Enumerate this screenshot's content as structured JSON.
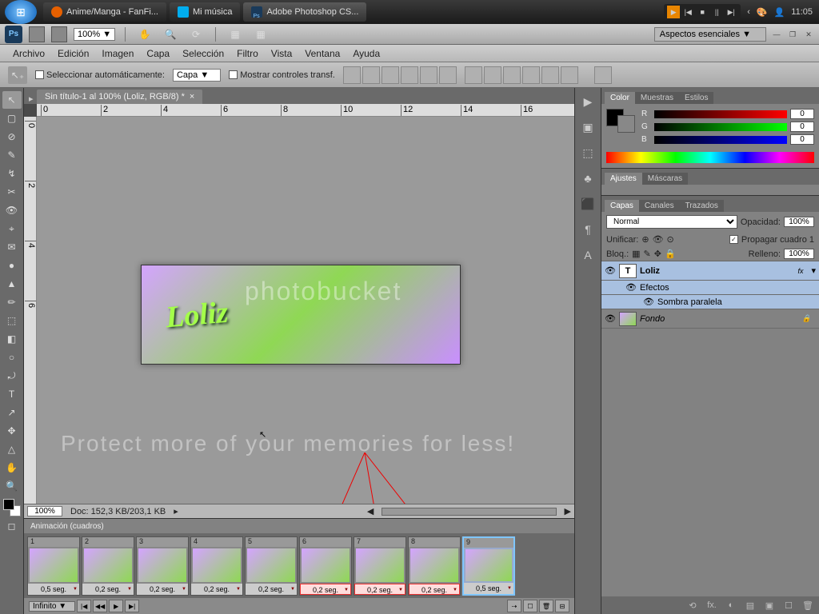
{
  "taskbar": {
    "items": [
      {
        "icon": "ff",
        "label": "Anime/Manga - FanFi..."
      },
      {
        "icon": "wmp",
        "label": "Mi música"
      },
      {
        "icon": "ps",
        "label": "Adobe Photoshop CS...",
        "active": true
      }
    ],
    "clock": "11:05",
    "media": {
      "play": "▶",
      "prev": "|◀",
      "stop": "■",
      "pause": "||",
      "next": "▶|"
    }
  },
  "top": {
    "zoom": "100% ▼",
    "icons": {
      "hand": "✋",
      "zoom": "🔍",
      "rotate": "⟳",
      "arrange1": "▦",
      "arrange2": "▦",
      "screen": "▢"
    },
    "workspace": "Aspectos esenciales  ▼"
  },
  "menu": [
    "Archivo",
    "Edición",
    "Imagen",
    "Capa",
    "Selección",
    "Filtro",
    "Vista",
    "Ventana",
    "Ayuda"
  ],
  "options": {
    "auto_select": "Seleccionar automáticamente:",
    "layer_select": "Capa        ▼",
    "show_transform": "Mostrar controles transf."
  },
  "document": {
    "tab": "Sin título-1 al 100% (Loliz, RGB/8) *",
    "ruler_h": [
      0,
      2,
      4,
      6,
      8,
      10,
      12,
      14,
      16
    ],
    "ruler_v": [
      0,
      2,
      4,
      6
    ],
    "art_text": "Loliz",
    "zoom": "100%",
    "docsize": "Doc: 152,3 KB/203,1 KB"
  },
  "watermark": {
    "wm1": "photobucket",
    "wm2": "Protect more of  your memories for less!"
  },
  "animation": {
    "title": "Animación (cuadros)",
    "frames": [
      {
        "n": 1,
        "d": "0,5 seg.",
        "hl": false,
        "sel": false
      },
      {
        "n": 2,
        "d": "0,2 seg.",
        "hl": false,
        "sel": false
      },
      {
        "n": 3,
        "d": "0,2 seg.",
        "hl": false,
        "sel": false
      },
      {
        "n": 4,
        "d": "0,2 seg.",
        "hl": false,
        "sel": false
      },
      {
        "n": 5,
        "d": "0,2 seg.",
        "hl": false,
        "sel": false
      },
      {
        "n": 6,
        "d": "0,2 seg.",
        "hl": true,
        "sel": false
      },
      {
        "n": 7,
        "d": "0,2 seg.",
        "hl": true,
        "sel": false
      },
      {
        "n": 8,
        "d": "0,2 seg.",
        "hl": true,
        "sel": false
      },
      {
        "n": 9,
        "d": "0,5 seg.",
        "hl": false,
        "sel": true
      }
    ],
    "loop": "Infinito ▼",
    "controls": {
      "first": "|◀",
      "prev": "◀◀",
      "play": "▶",
      "next": "▶|"
    }
  },
  "panels": {
    "color": {
      "tabs": [
        "Color",
        "Muestras",
        "Estilos"
      ],
      "r": "0",
      "g": "0",
      "b": "0",
      "channels": {
        "r": "R",
        "g": "G",
        "b": "B"
      }
    },
    "adjust": {
      "tabs": [
        "Ajustes",
        "Máscaras"
      ]
    },
    "layers": {
      "tabs": [
        "Capas",
        "Canales",
        "Trazados"
      ],
      "blend": "Normal",
      "opacity_label": "Opacidad:",
      "opacity": "100%",
      "unify": "Unificar:",
      "propagate": "Propagar cuadro 1",
      "lock_label": "Bloq.:",
      "fill_label": "Relleno:",
      "fill": "100%",
      "items": [
        {
          "name": "Loliz",
          "type": "text",
          "sel": true,
          "fx": "fx"
        },
        {
          "name": "Efectos",
          "type": "fx",
          "sub": 1
        },
        {
          "name": "Sombra paralela",
          "type": "fx",
          "sub": 2
        },
        {
          "name": "Fondo",
          "type": "bg",
          "locked": true
        }
      ],
      "footer_icons": [
        "⟲",
        "fx.",
        "◐",
        "▤",
        "▣",
        "☐",
        "🗑"
      ]
    }
  },
  "tools": [
    "↖",
    "▢",
    "⊘",
    "✎",
    "↯",
    "✂",
    "👁",
    "⌖",
    "✉",
    "●",
    "▲",
    "✏",
    "⬚",
    "◧",
    "○",
    "⤾",
    "△",
    "T",
    "↗",
    "✥",
    "✋",
    "🔍"
  ],
  "iconbar": [
    "▶",
    "▣",
    "⬚",
    "♣",
    "⬛",
    "¶",
    "A"
  ]
}
